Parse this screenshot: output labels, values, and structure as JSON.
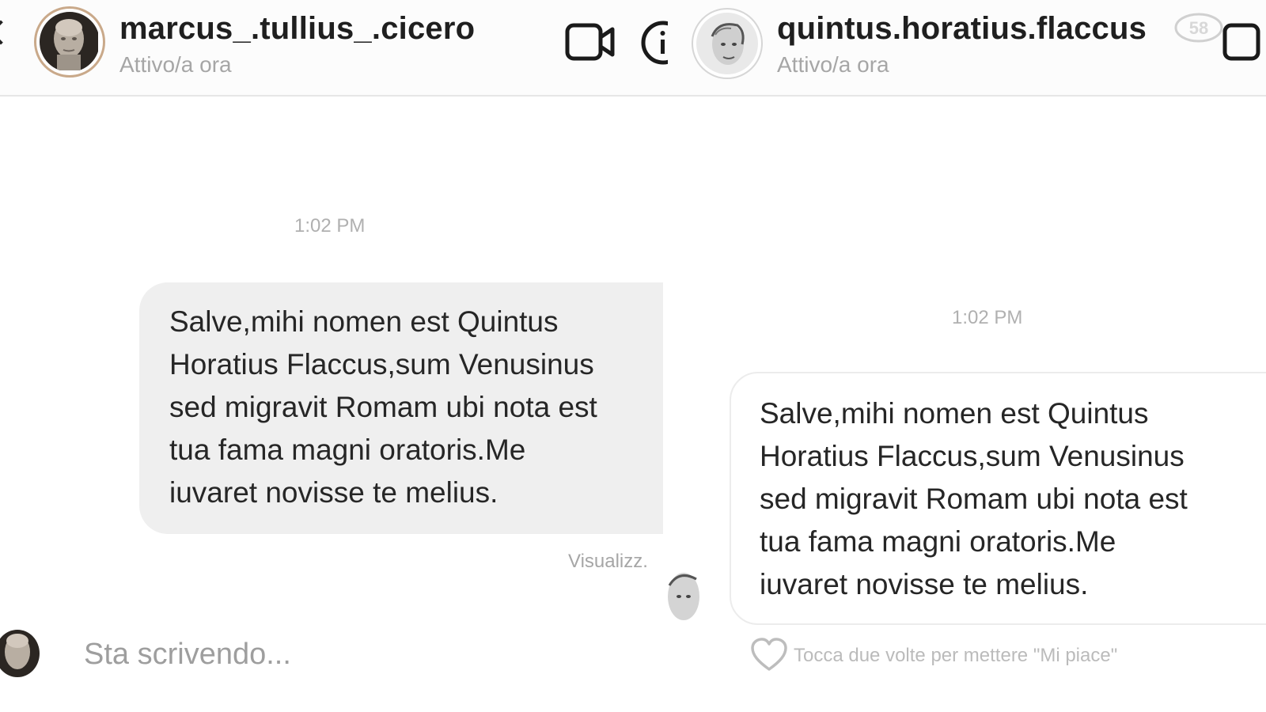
{
  "left_chat": {
    "header": {
      "username": "marcus_.tullius_.cicero",
      "status": "Attivo/a ora"
    },
    "timestamp": "1:02 PM",
    "message": "Salve,mihi nomen est Quintus\nHoratius Flaccus,sum Venusinus\nsed migravit Romam ubi nota est\ntua fama magni oratoris.Me\niuvaret novisse te melius.",
    "seen_label": "Visualizz.",
    "composer": {
      "typing_text": "Sta scrivendo..."
    }
  },
  "right_chat": {
    "header": {
      "username": "quintus.horatius.flaccus",
      "status": "Attivo/a ora"
    },
    "timestamp": "1:02 PM",
    "message": "Salve,mihi nomen est Quintus\nHoratius Flaccus,sum Venusinus\nsed migravit Romam ubi nota est\ntua fama magni oratoris.Me\niuvaret novisse te melius.",
    "like_hint": "Tocca due volte per mettere \"Mi piace\""
  },
  "channel_logo": {
    "text": "58"
  },
  "icons": {
    "back": "chevron-left-icon",
    "video": "video-camera-icon",
    "info": "info-icon",
    "heart": "heart-icon"
  }
}
